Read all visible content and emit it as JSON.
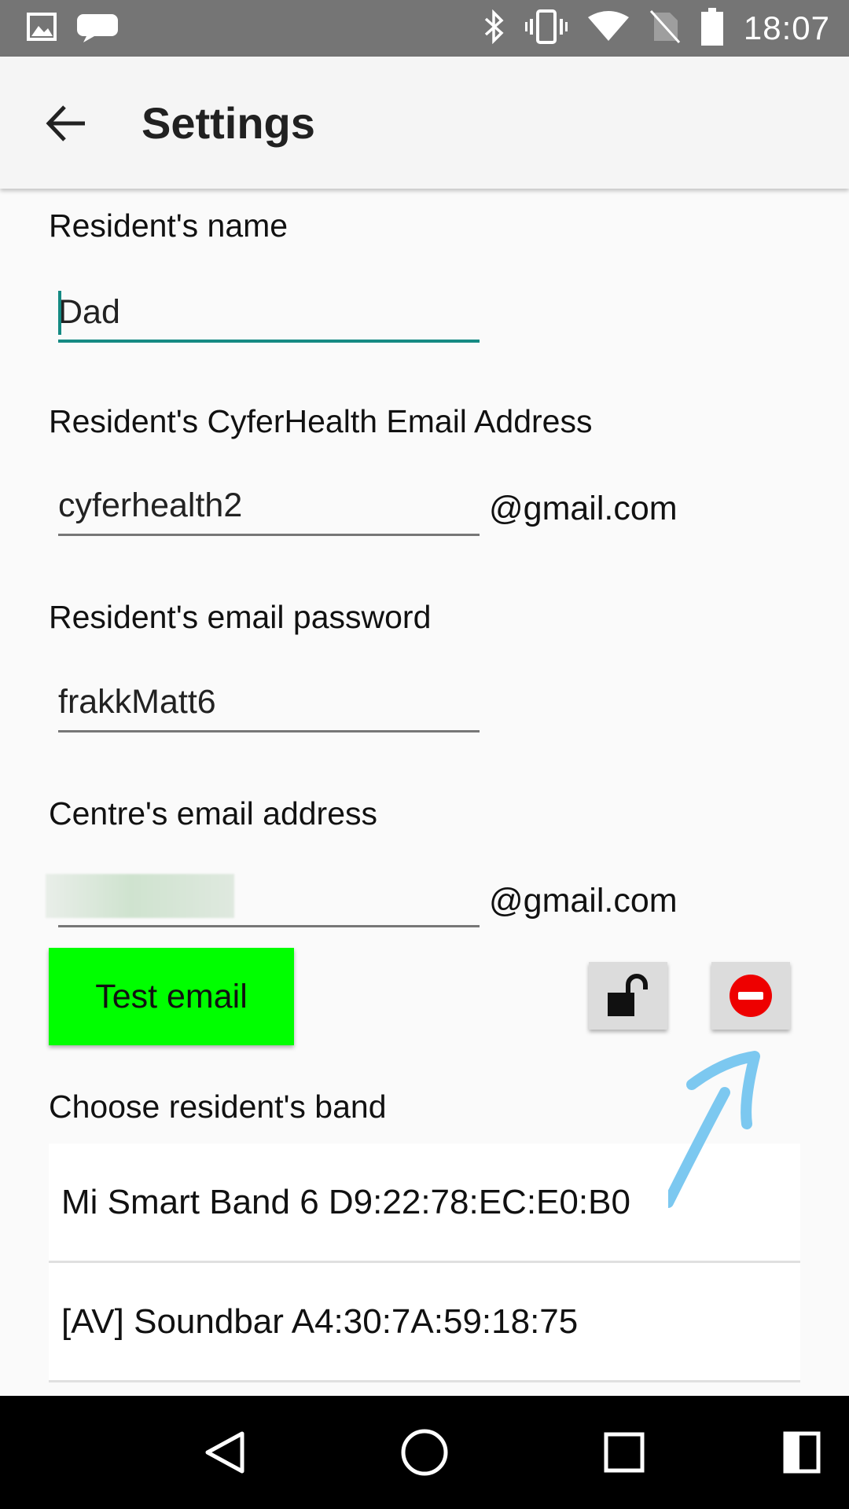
{
  "status_bar": {
    "time": "18:07",
    "left_icons": [
      "image-notification-icon",
      "chat-notification-icon"
    ],
    "right_icons": [
      "bluetooth-icon",
      "vibrate-icon",
      "wifi-icon",
      "no-sim-icon",
      "battery-icon"
    ]
  },
  "toolbar": {
    "title": "Settings",
    "back_icon": "arrow-back-icon"
  },
  "form": {
    "resident_name": {
      "label": "Resident's name",
      "value": "Dad"
    },
    "cyferhealth_email": {
      "label": "Resident's CyferHealth Email Address",
      "value": "cyferhealth2",
      "suffix": "@gmail.com"
    },
    "email_password": {
      "label": "Resident's email password",
      "value": "frakkMatt6"
    },
    "centre_email": {
      "label": "Centre's email address",
      "value": "",
      "suffix": "@gmail.com"
    }
  },
  "actions": {
    "test_email_label": "Test email",
    "unlock_icon": "unlock-icon",
    "remove_icon": "remove-circle-icon"
  },
  "bands": {
    "label": "Choose resident's band",
    "items": [
      {
        "label": "Mi Smart Band 6  D9:22:78:EC:E0:B0"
      },
      {
        "label": "[AV] Soundbar  A4:30:7A:59:18:75"
      }
    ]
  },
  "nav_bar": {
    "icons": [
      "nav-back-icon",
      "nav-home-icon",
      "nav-recents-icon",
      "nav-split-icon"
    ]
  },
  "colors": {
    "status_bar": "#757575",
    "accent": "#158a83",
    "test_button": "#00ff00",
    "remove_red": "#ee0000",
    "annotation_arrow": "#7cc8f0"
  }
}
